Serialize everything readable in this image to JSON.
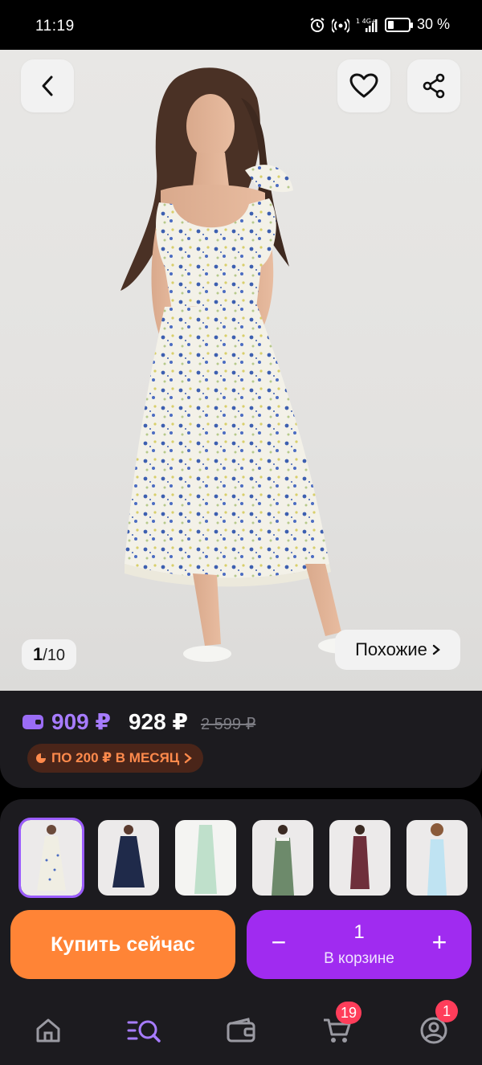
{
  "status_bar": {
    "time": "11:19",
    "network": "4G+",
    "battery_percent_text": "30 %",
    "battery_level": 0.3
  },
  "product_gallery": {
    "current_image": "1",
    "total_images": "10",
    "separator": "/",
    "similar_label": "Похожие",
    "back_icon": "chevron-left-icon",
    "favorite_icon": "heart-icon",
    "share_icon": "share-icon"
  },
  "price": {
    "wallet_price": "909 ₽",
    "current_price": "928 ₽",
    "old_price": "2 599 ₽",
    "installment_label": "ПО 200 ₽ В МЕСЯЦ",
    "wallet_color": "#a77cff"
  },
  "variants": [
    {
      "name": "floral-white-dress",
      "selected": true
    },
    {
      "name": "navy-polka-dress",
      "selected": false
    },
    {
      "name": "mint-dress",
      "selected": false
    },
    {
      "name": "green-lace-dress",
      "selected": false
    },
    {
      "name": "burgundy-floral-dress",
      "selected": false
    },
    {
      "name": "light-blue-dress",
      "selected": false
    }
  ],
  "actions": {
    "buy_now_label": "Купить сейчас",
    "cart_quantity": "1",
    "cart_label": "В корзине",
    "minus_label": "−",
    "plus_label": "+",
    "buy_color": "#ff8436",
    "cart_color": "#a02bf0"
  },
  "bottom_nav": {
    "items": [
      {
        "name": "home",
        "icon": "home-icon"
      },
      {
        "name": "catalog",
        "icon": "catalog-search-icon",
        "active": true
      },
      {
        "name": "wallet",
        "icon": "wallet-icon"
      },
      {
        "name": "cart",
        "icon": "cart-icon",
        "badge": "19"
      },
      {
        "name": "profile",
        "icon": "profile-icon",
        "badge": "1"
      }
    ],
    "active_color": "#a77cff"
  }
}
